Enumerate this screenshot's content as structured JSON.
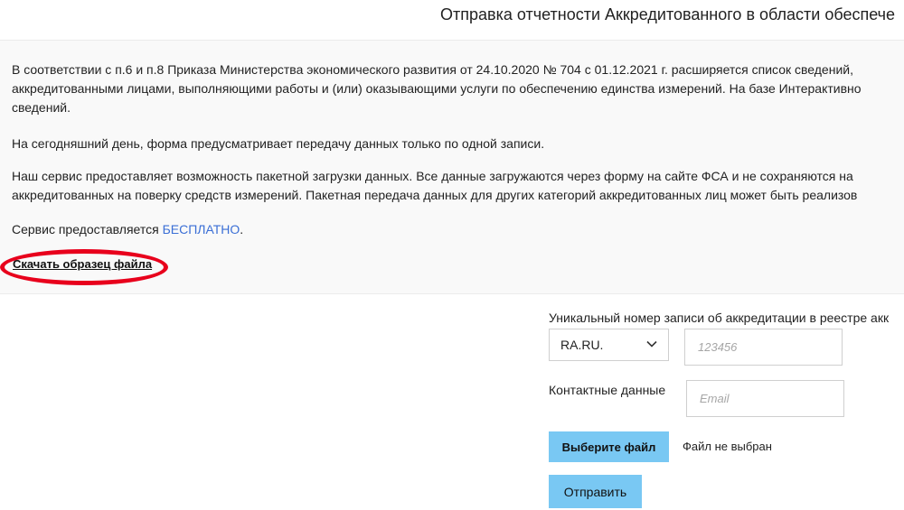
{
  "header": {
    "title": "Отправка отчетности Аккредитованного в области обеспече"
  },
  "content": {
    "paragraphs": [
      "В соответствии с п.6 и п.8 Приказа Министерства экономического развития от 24.10.2020 № 704 с 01.12.2021 г. расширяется список сведений,",
      "аккредитованными лицами, выполняющими работы и (или) оказывающими услуги по обеспечению единства измерений. На базе Интерактивно",
      "сведений.",
      "На сегодняшний день, форма предусматривает передачу данных только по одной записи.",
      "Наш сервис предоставляет возможность пакетной загрузки данных. Все данные загружаются через форму на сайте ФСА и не сохраняются на",
      "аккредитованных на поверку средств измерений. Пакетная передача данных для других категорий аккредитованных лиц может быть реализов"
    ],
    "service_prefix": "Сервис предоставляется ",
    "service_free": "БЕСПЛАТНО",
    "service_suffix": ".",
    "download_link": "Скачать образец файла"
  },
  "form": {
    "registry_label": "Уникальный номер записи об аккредитации в реестре акк",
    "prefix_select": "RA.RU.",
    "registry_placeholder": "123456",
    "contact_label": "Контактные данные",
    "email_placeholder": "Email",
    "choose_file_label": "Выберите файл",
    "file_status": "Файл не выбран",
    "submit_label": "Отправить"
  },
  "colors": {
    "accent_button": "#79c8f3",
    "link_blue": "#3b6fd6",
    "highlight_red": "#e8001c"
  },
  "icons": {
    "select_chevron": "chevron-down-icon"
  }
}
